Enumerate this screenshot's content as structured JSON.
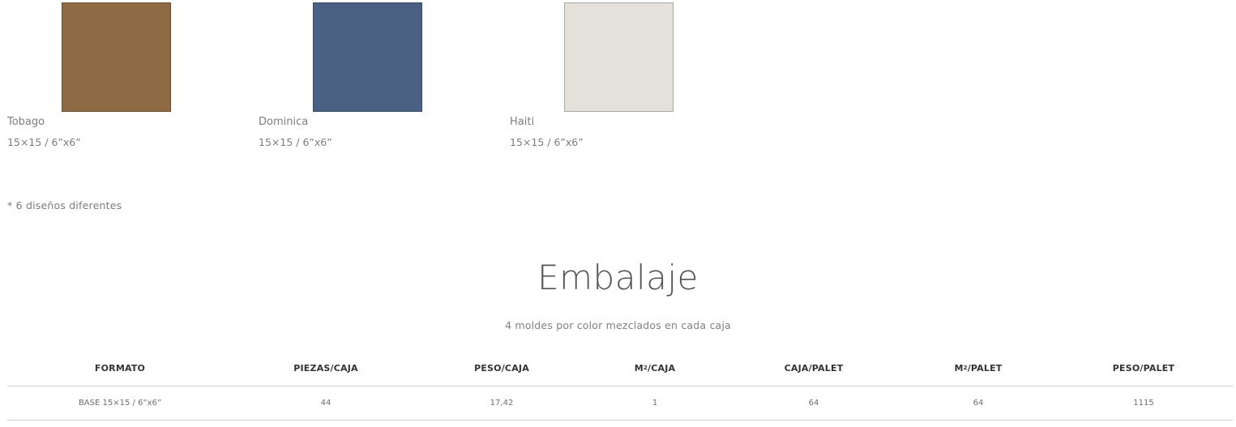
{
  "tiles": [
    {
      "name": "Tobago",
      "size": "15×15 / 6”x6”",
      "color": "#8e6a45"
    },
    {
      "name": "Dominica",
      "size": "15×15 / 6”x6”",
      "color": "#4a6184"
    },
    {
      "name": "Haiti",
      "size": "15×15 / 6”x6”",
      "color": "#e3e1da"
    }
  ],
  "note": "* 6 diseños diferentes",
  "section": {
    "title": "Embalaje",
    "subtitle": "4 moldes por color mezclados en cada caja"
  },
  "table": {
    "headers": {
      "formato": "FORMATO",
      "piezas_caja": "PIEZAS/CAJA",
      "peso_caja": "PESO/CAJA",
      "m2_caja_prefix": "M",
      "m2_caja_sup": "2",
      "m2_caja_suffix": "/CAJA",
      "caja_palet": "CAJA/PALET",
      "m2_palet_prefix": "M",
      "m2_palet_sup": "2",
      "m2_palet_suffix": "/PALET",
      "peso_palet": "PESO/PALET"
    },
    "rows": [
      [
        "BASE 15×15 / 6”x6”",
        "44",
        "17,42",
        "1",
        "64",
        "64",
        "1115"
      ]
    ]
  }
}
